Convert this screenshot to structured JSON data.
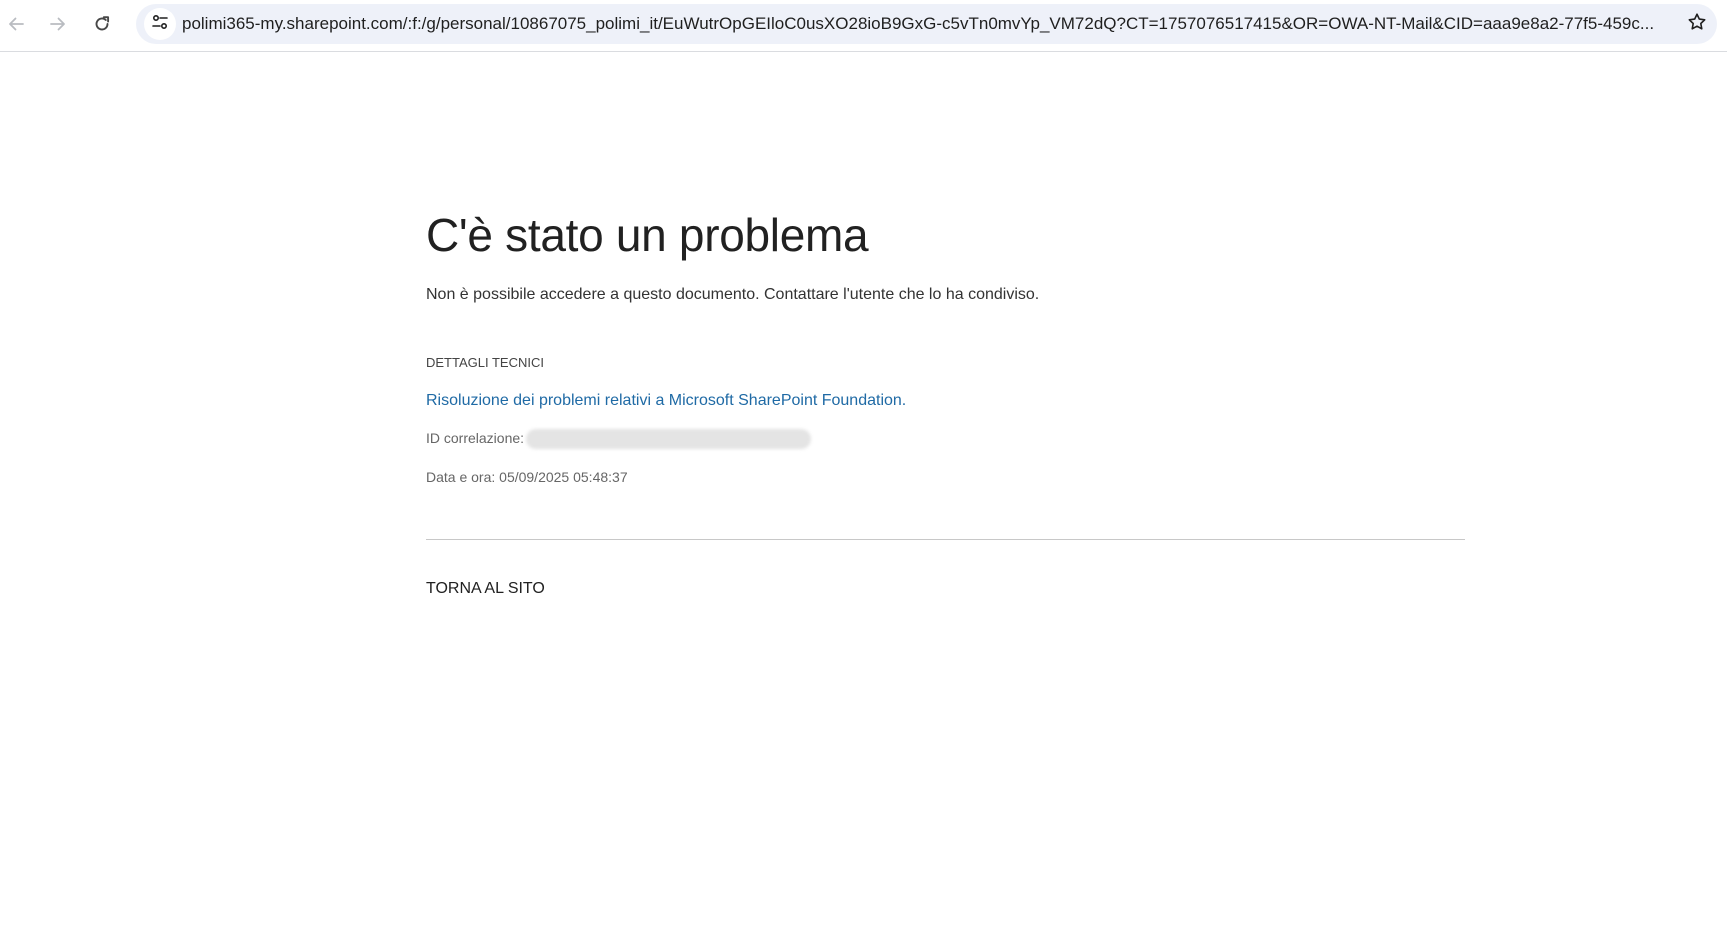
{
  "browser": {
    "url": "polimi365-my.sharepoint.com/:f:/g/personal/10867075_polimi_it/EuWutrOpGEIloC0usXO28ioB9GxG-c5vTn0mvYp_VM72dQ?CT=1757076517415&OR=OWA-NT-Mail&CID=aaa9e8a2-77f5-459c...",
    "icons": {
      "back": "back-arrow-icon",
      "forward": "forward-arrow-icon",
      "reload": "reload-icon",
      "site_info": "tune-icon",
      "bookmark": "star-icon"
    }
  },
  "error_page": {
    "title": "C'è stato un problema",
    "message": "Non è possibile accedere a questo documento. Contattare l'utente che lo ha condiviso.",
    "tech_details_heading": "DETTAGLI TECNICI",
    "troubleshoot_link": "Risoluzione dei problemi relativi a Microsoft SharePoint Foundation.",
    "correlation_label": "ID correlazione:",
    "datetime": "Data e ora: 05/09/2025 05:48:37",
    "back_to_site": "TORNA AL SITO"
  },
  "colors": {
    "link": "#1f6aa5",
    "omnibox_bg": "#eef1f9",
    "title_text": "#212121"
  }
}
